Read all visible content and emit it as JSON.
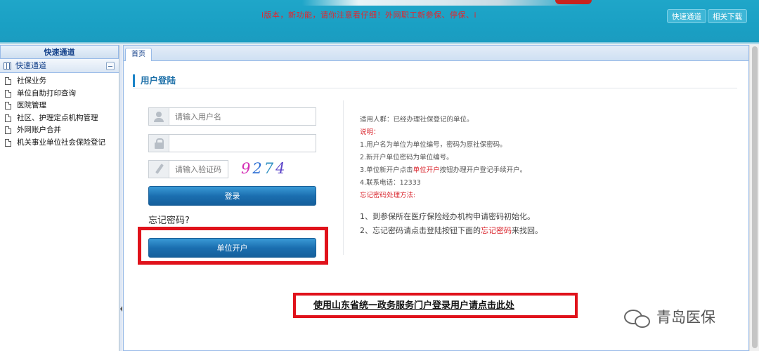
{
  "header": {
    "notice": "i版本，新功能，请你注意看仔细！外网职工新参保、停保、i",
    "buttons": [
      "快速通道",
      "相关下载"
    ]
  },
  "sidebar": {
    "title": "快速通道",
    "section": "快速通道",
    "items": [
      "社保业务",
      "单位自助打印查询",
      "医院管理",
      "社区、护理定点机构管理",
      "外网账户合并",
      "机关事业单位社会保险登记"
    ]
  },
  "tabs": [
    "首页"
  ],
  "login": {
    "section_title": "用户登陆",
    "username_placeholder": "请输入用户名",
    "password_placeholder": "",
    "captcha_placeholder": "请输入验证码",
    "captcha_value": [
      "9",
      "2",
      "7",
      "4"
    ],
    "login_button": "登录",
    "forgot": "忘记密码?",
    "open_account_button": "单位开户"
  },
  "info": {
    "audience": "适用人群：已经办理社保登记的单位。",
    "note_label": "说明：",
    "note1": "1.用户名为单位为单位编号，密码为原社保密码。",
    "note2": "2.新开户单位密码为单位编号。",
    "note3_pre": "3.单位新开户点击",
    "note3_hl": "单位开户",
    "note3_post": "按钮办理开户登记手续开户。",
    "note4": "4.联系电话：12333",
    "forgot_method": "忘记密码处理方法:",
    "step1": "1、到参保所在医疗保险经办机构申请密码初始化。",
    "step2_pre": "2、忘记密码请点击登陆按钮下面的",
    "step2_hl": "忘记密码",
    "step2_post": "来找回。"
  },
  "portal_link": "使用山东省统一政务服务门户登录用户请点击此处",
  "watermark": "青岛医保",
  "colors": {
    "header": "#1aa0c4",
    "highlight": "#e0121b",
    "button": "#1b6fb0"
  }
}
